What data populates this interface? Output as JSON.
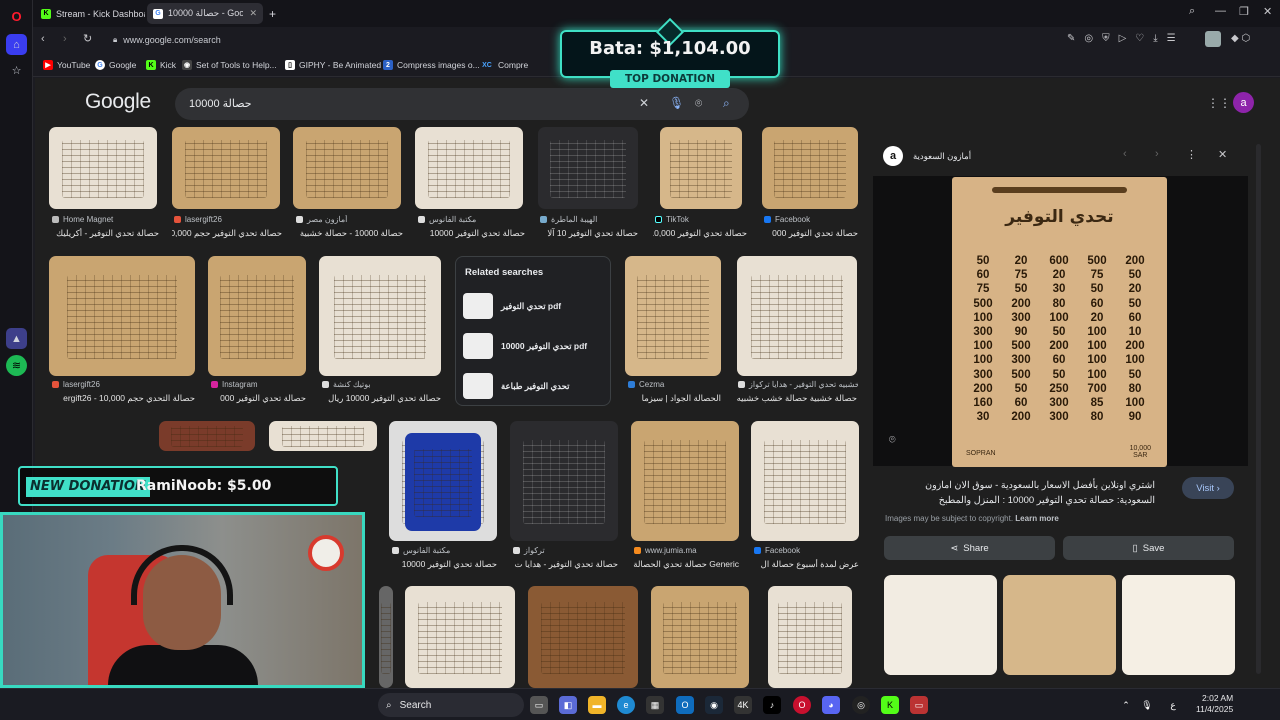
{
  "browser": {
    "tabs": [
      {
        "label": "Stream - Kick Dashboard",
        "icon": "kick-icon"
      },
      {
        "label": "حصالة 10000 - Google Search",
        "icon": "google-icon"
      }
    ],
    "url": "www.google.com/search",
    "bookmarks": [
      "YouTube",
      "Google",
      "Kick",
      "Set of Tools to Help...",
      "GIPHY - Be Animated",
      "Compress images o...",
      "Compre"
    ]
  },
  "google": {
    "logo": "Google",
    "query": "حصالة 10000",
    "avatar_letter": "a"
  },
  "results": {
    "row1": [
      {
        "source": "Home Magnet",
        "caption": "حصالة تحدي التوفير - أكريليك"
      },
      {
        "source": "lasergift26",
        "caption": "حصالة تحدي التوفير حجم 10,000"
      },
      {
        "source": "أمازون مصر",
        "caption": "حصالة 10000 - حصالة خشبية"
      },
      {
        "source": "مكتبة الفانوس",
        "caption": "حصالة تحدي التوفير 10000"
      },
      {
        "source": "الهيبة الماطرة",
        "caption": "حصالة تحدي التوفير 10 آلا"
      },
      {
        "source": "TikTok",
        "caption": "حصالة تحدي التوفير 10,000 ج"
      },
      {
        "source": "Facebook",
        "caption": "حصالة تحدي التوفير 000"
      }
    ],
    "row2": [
      {
        "source": "lasergift26",
        "caption": "حصالة التحدي حجم 10,000 - ergift26"
      },
      {
        "source": "Instagram",
        "caption": "حصالة تحدي التوفير 000"
      },
      {
        "source": "بوتيك كنشة",
        "caption": "حصالة تحدي التوفير 10000 ريال"
      },
      {
        "source": "Cezma",
        "caption": "الحصالة الجواد | سيزما"
      },
      {
        "source": "ب خشبيه تحدي التوفير - هدايا تركواز",
        "caption": "حصالة خشبية حصالة خشب خشبيه"
      }
    ],
    "row3": [
      {
        "source": "مكتبة الفانوس",
        "caption": "حصالة تحدي التوفير 10000"
      },
      {
        "source": "تركواز",
        "caption": "حصالة تحدي التوفير - هدايا ت"
      },
      {
        "source": "www.jumia.ma",
        "caption": "Generic حصالة تحدي الحصالة من"
      },
      {
        "source": "Facebook",
        "caption": "عرض لمدة أسبوع حصالة ال"
      }
    ],
    "related": {
      "heading": "Related searches",
      "items": [
        "تحدي التوفير pdf",
        "تحدي التوفير 10000 pdf",
        "تحدي التوفير طباعة"
      ]
    }
  },
  "panel": {
    "source": "أمازون السعودية",
    "box_title": "تحدي التوفير",
    "box_values": [
      "50",
      "20",
      "600",
      "500",
      "200",
      "60",
      "75",
      "20",
      "75",
      "50",
      "75",
      "50",
      "30",
      "50",
      "20",
      "500",
      "200",
      "80",
      "60",
      "50",
      "100",
      "300",
      "100",
      "20",
      "60",
      "300",
      "90",
      "50",
      "100",
      "10",
      "100",
      "500",
      "200",
      "100",
      "200",
      "100",
      "300",
      "60",
      "100",
      "100",
      "300",
      "500",
      "50",
      "100",
      "50",
      "200",
      "50",
      "250",
      "700",
      "80",
      "160",
      "60",
      "300",
      "85",
      "100",
      "30",
      "200",
      "300",
      "80",
      "90"
    ],
    "box_brand": "SOPRAN",
    "box_total": "10,000",
    "box_currency": "SAR",
    "description": "اشتري اونلاين بأفضل الاسعار بالسعودية - سوق الان امازون السعودية: حصالة تحدي التوفير 10000 : المنزل والمطبخ",
    "visit": "Visit",
    "copyright": "Images may be subject to copyright.",
    "learn_more": "Learn more",
    "share": "Share",
    "save": "Save"
  },
  "overlay": {
    "top_donation_amount": "Bata: $1,104.00",
    "top_donation_label": "TOP DONATION",
    "new_donation_label": "NEW DONATION",
    "new_donation_msg": "RamiNoob: $5.00"
  },
  "taskbar": {
    "search": "Search",
    "time": "2:02 AM",
    "date": "11/4/2025"
  },
  "colors": {
    "accent": "#40e0c8",
    "kick": "#53fc18",
    "google_bg": "#1f1f1f"
  }
}
